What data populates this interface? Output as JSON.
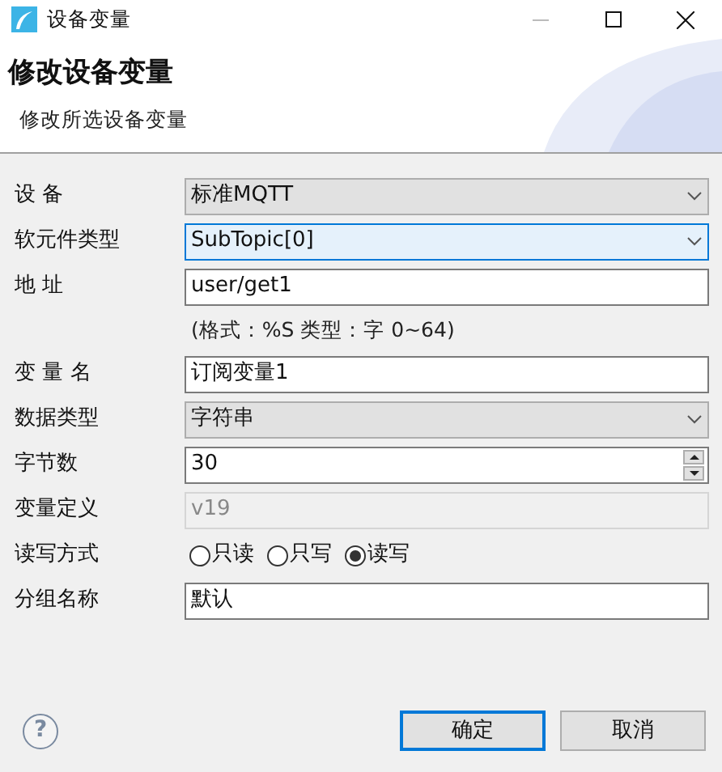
{
  "window": {
    "title": "设备变量"
  },
  "header": {
    "title": "修改设备变量",
    "subtitle": "修改所选设备变量"
  },
  "rows": [
    {
      "kind": "select",
      "label": "设 备",
      "value": "标准MQTT",
      "focused": false
    },
    {
      "kind": "select",
      "label": "软元件类型",
      "value": "SubTopic[0]",
      "focused": true
    },
    {
      "kind": "text",
      "label": "地 址",
      "value": "user/get1",
      "disabled": false
    },
    {
      "kind": "hint",
      "value": "(格式：%S 类型：字 0~64)"
    },
    {
      "kind": "text",
      "label": "变 量 名",
      "value": "订阅变量1",
      "disabled": false
    },
    {
      "kind": "select",
      "label": "数据类型",
      "value": "字符串",
      "focused": false
    },
    {
      "kind": "spinner",
      "label": "字节数",
      "value": "30"
    },
    {
      "kind": "text",
      "label": "变量定义",
      "value": "v19",
      "disabled": true
    },
    {
      "kind": "radio",
      "label": "读写方式",
      "options": [
        {
          "label": "只读",
          "selected": false
        },
        {
          "label": "只写",
          "selected": false
        },
        {
          "label": "读写",
          "selected": true
        }
      ]
    },
    {
      "kind": "text",
      "label": "分组名称",
      "value": "默认",
      "disabled": false
    }
  ],
  "help": "?",
  "buttons": [
    {
      "label": "确定",
      "default": true
    },
    {
      "label": "取消",
      "default": false
    }
  ]
}
